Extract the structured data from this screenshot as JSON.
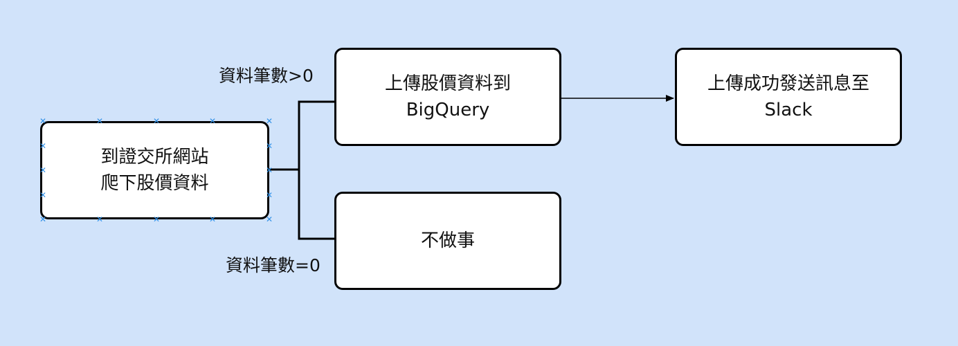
{
  "diagram": {
    "background_color": "#d1e3fa",
    "nodes": {
      "crawl": {
        "label": "到證交所網站\n爬下股價資料"
      },
      "upload_bq": {
        "label": "上傳股價資料到\nBigQuery"
      },
      "notify_slack": {
        "label": "上傳成功發送訊息至\nSlack"
      },
      "do_nothing": {
        "label": "不做事"
      }
    },
    "edges": {
      "to_upload": {
        "label": "資料筆數>0"
      },
      "to_nothing": {
        "label": "資料筆數=0"
      },
      "to_slack": {
        "label": ""
      }
    },
    "selection_handle_icon": "x-mark-icon",
    "selection_handle_color": "#2f8fe6"
  }
}
